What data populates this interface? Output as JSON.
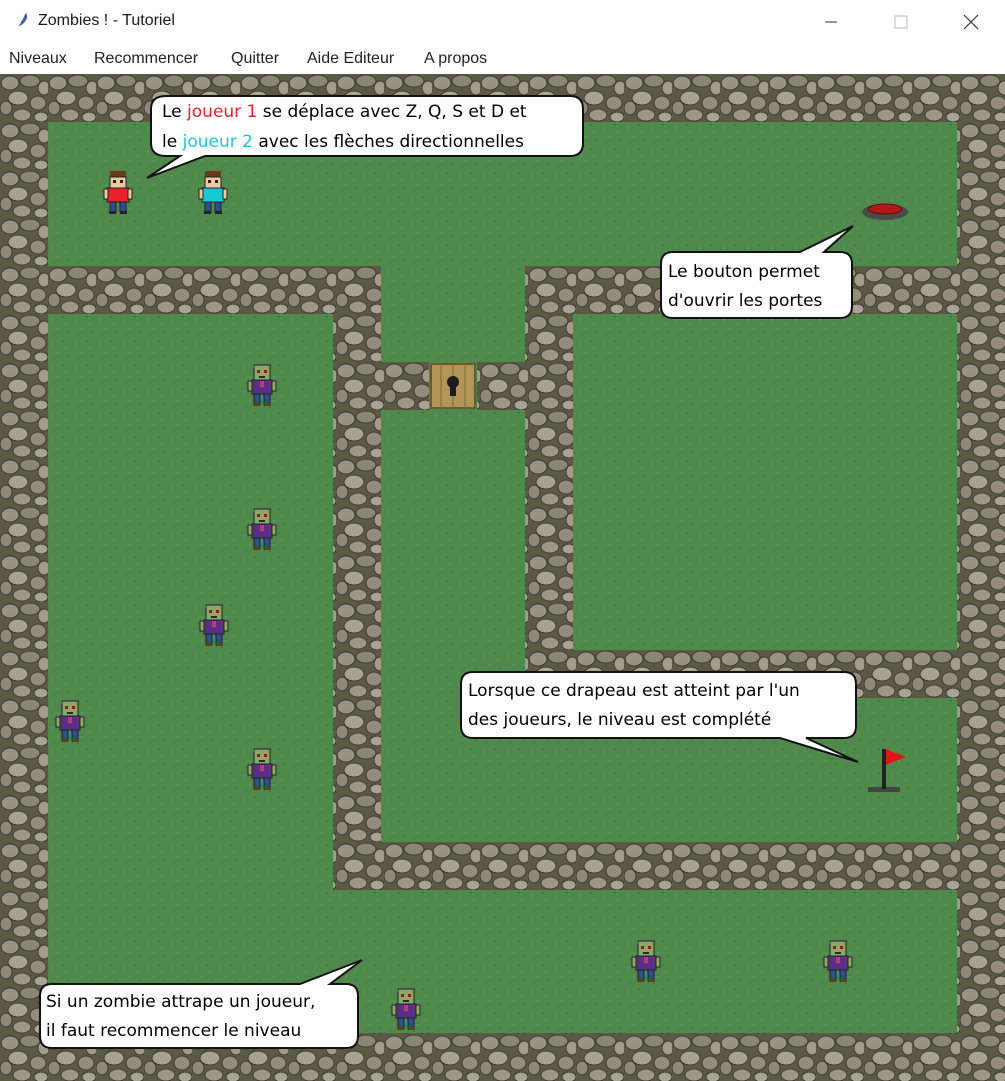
{
  "window": {
    "title": "Zombies ! - Tutoriel",
    "controls": [
      "minimize",
      "maximize",
      "close"
    ]
  },
  "menu": {
    "items": [
      "Niveaux",
      "Recommencer",
      "Quitter",
      "Aide Editeur",
      "A propos"
    ]
  },
  "tips": {
    "controls": {
      "l1_a": "Le ",
      "player1": "joueur 1",
      "l1_b": " se déplace avec Z, Q, S et D et",
      "l2_a": "le ",
      "player2": "joueur 2",
      "l2_b": " avec les flèches directionnelles"
    },
    "button": {
      "line1": "Le bouton permet",
      "line2": "d'ouvrir les portes"
    },
    "flag": {
      "line1": "Lorsque ce drapeau est atteint par l'un",
      "line2": "des joueurs, le niveau est complété"
    },
    "zombie": {
      "line1": "Si un zombie attrape un joueur,",
      "line2": "il faut recommencer le niveau"
    }
  },
  "colors": {
    "grass": "#4f8a4c",
    "stone": "#8f8778",
    "player1": "#e8202a",
    "player2": "#19c8d6",
    "zombie_shirt": "#5a2f86",
    "flag": "#e01515",
    "button": "#b01a1a",
    "door": "#b39657"
  }
}
